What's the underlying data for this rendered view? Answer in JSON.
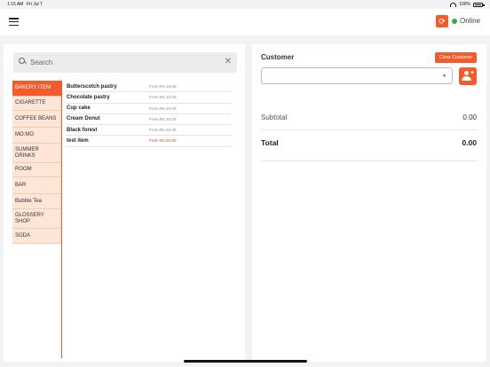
{
  "status_bar": {
    "time": "1:15 AM",
    "date": "Fri Jul 7",
    "battery": "100%"
  },
  "header": {
    "status_label": "Online",
    "refresh_icon": "refresh-icon"
  },
  "search": {
    "placeholder": "Search",
    "value": ""
  },
  "categories": [
    {
      "label": "BAKERY ITEM",
      "active": true
    },
    {
      "label": "CIGARETTE",
      "active": false
    },
    {
      "label": "COFFEE BEANS",
      "active": false
    },
    {
      "label": "MO:MO",
      "active": false
    },
    {
      "label": "SUMMER DRINKS",
      "active": false
    },
    {
      "label": "ROOM",
      "active": false
    },
    {
      "label": "BAR",
      "active": false
    },
    {
      "label": "Bubble Tea",
      "active": false
    },
    {
      "label": "GLOSSERY SHOP",
      "active": false
    },
    {
      "label": "SODA",
      "active": false
    }
  ],
  "items": [
    {
      "name": "Butterscotch pastry",
      "price": "From Rs 15.00",
      "highlight": false
    },
    {
      "name": "Chocolate pastry",
      "price": "From Rs 10.00",
      "highlight": false
    },
    {
      "name": "Cup cake",
      "price": "From Rs 10.00",
      "highlight": false
    },
    {
      "name": "Cream Donut",
      "price": "From Rs 15.00",
      "highlight": false
    },
    {
      "name": "Black forest",
      "price": "From Rs 25.00",
      "highlight": false
    },
    {
      "name": "test item",
      "price": "From Rs 25.00",
      "highlight": true
    }
  ],
  "customer": {
    "label": "Customer",
    "clear_label": "Clear Customer",
    "selected_value": ""
  },
  "totals": {
    "subtotal_label": "Subtotal",
    "subtotal_value": "0.00",
    "total_label": "Total",
    "total_value": "0.00"
  },
  "colors": {
    "accent": "#f25c2c",
    "online": "#3aa84a",
    "category_bg": "#fde6d7",
    "price_highlight": "#e03a2a"
  }
}
